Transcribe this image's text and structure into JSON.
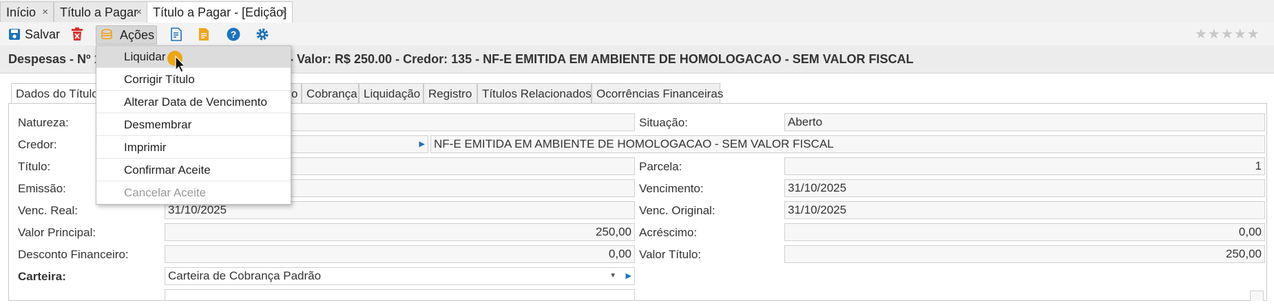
{
  "window_tabs": [
    {
      "label": "Início",
      "close": "×"
    },
    {
      "label": "Título a Pagar",
      "close": "×"
    },
    {
      "label": "Título a Pagar - [Edição]",
      "close": "×"
    }
  ],
  "toolbar": {
    "save_label": "Salvar",
    "actions_label": "Ações",
    "stars": "★★★★★"
  },
  "record_title": {
    "prefix": "Despesas - Nº 1",
    "suffix": "5 - Valor: R$ 250.00 - Credor: 135 - NF-E EMITIDA EM AMBIENTE DE HOMOLOGACAO - SEM VALOR FISCAL"
  },
  "form_tabs": [
    "Dados do Título",
    "o",
    "Cobrança",
    "Liquidação",
    "Registro",
    "Títulos Relacionados",
    "Ocorrências Financeiras"
  ],
  "actions_menu": [
    "Liquidar",
    "Corrigir Título",
    "Alterar Data de Vencimento",
    "Desmembrar",
    "Imprimir",
    "Confirmar Aceite",
    "Cancelar Aceite"
  ],
  "fields": {
    "natureza_label": "Natureza:",
    "natureza_value": "",
    "situacao_label": "Situação:",
    "situacao_value": "Aberto",
    "credor_label": "Credor:",
    "credor_code": "",
    "credor_name": "NF-E EMITIDA EM AMBIENTE DE HOMOLOGACAO - SEM VALOR FISCAL",
    "titulo_label": "Título:",
    "titulo_value": "",
    "parcela_label": "Parcela:",
    "parcela_value": "1",
    "emissao_label": "Emissão:",
    "emissao_value": "",
    "vencimento_label": "Vencimento:",
    "vencimento_value": "31/10/2025",
    "venc_real_label": "Venc. Real:",
    "venc_real_value": "31/10/2025",
    "venc_original_label": "Venc. Original:",
    "venc_original_value": "31/10/2025",
    "valor_principal_label": "Valor Principal:",
    "valor_principal_value": "250,00",
    "acrescimo_label": "Acréscimo:",
    "acrescimo_value": "0,00",
    "desconto_label": "Desconto Financeiro:",
    "desconto_value": "0,00",
    "valor_titulo_label": "Valor Título:",
    "valor_titulo_value": "250,00",
    "carteira_label": "Carteira:",
    "carteira_value": "Carteira de Cobrança Padrão"
  },
  "colors": {
    "accent_blue": "#1e73be",
    "delete_red": "#d9302c",
    "doc_orange": "#f2a31b",
    "cursor_orange": "#f0a000"
  }
}
